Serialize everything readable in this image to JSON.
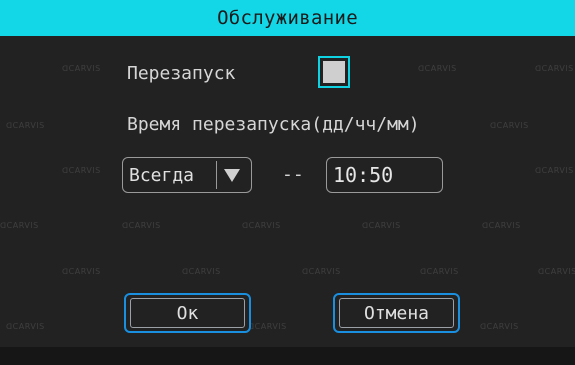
{
  "dialog": {
    "title": "Обслуживание",
    "restart_label": "Перезапуск",
    "restart_checked": false,
    "restart_time_label": "Время перезапуска(дд/чч/мм)",
    "repeat_select_value": "Всегда",
    "separator": "--",
    "time_value": "10:50",
    "ok_label": "Ок",
    "cancel_label": "Отмена",
    "watermark_text": "CARVIS"
  },
  "colors": {
    "title_bar": "#13d7e6",
    "focus_border": "#0fd2e2",
    "button_border": "#1a8fe0",
    "background": "#222222"
  }
}
